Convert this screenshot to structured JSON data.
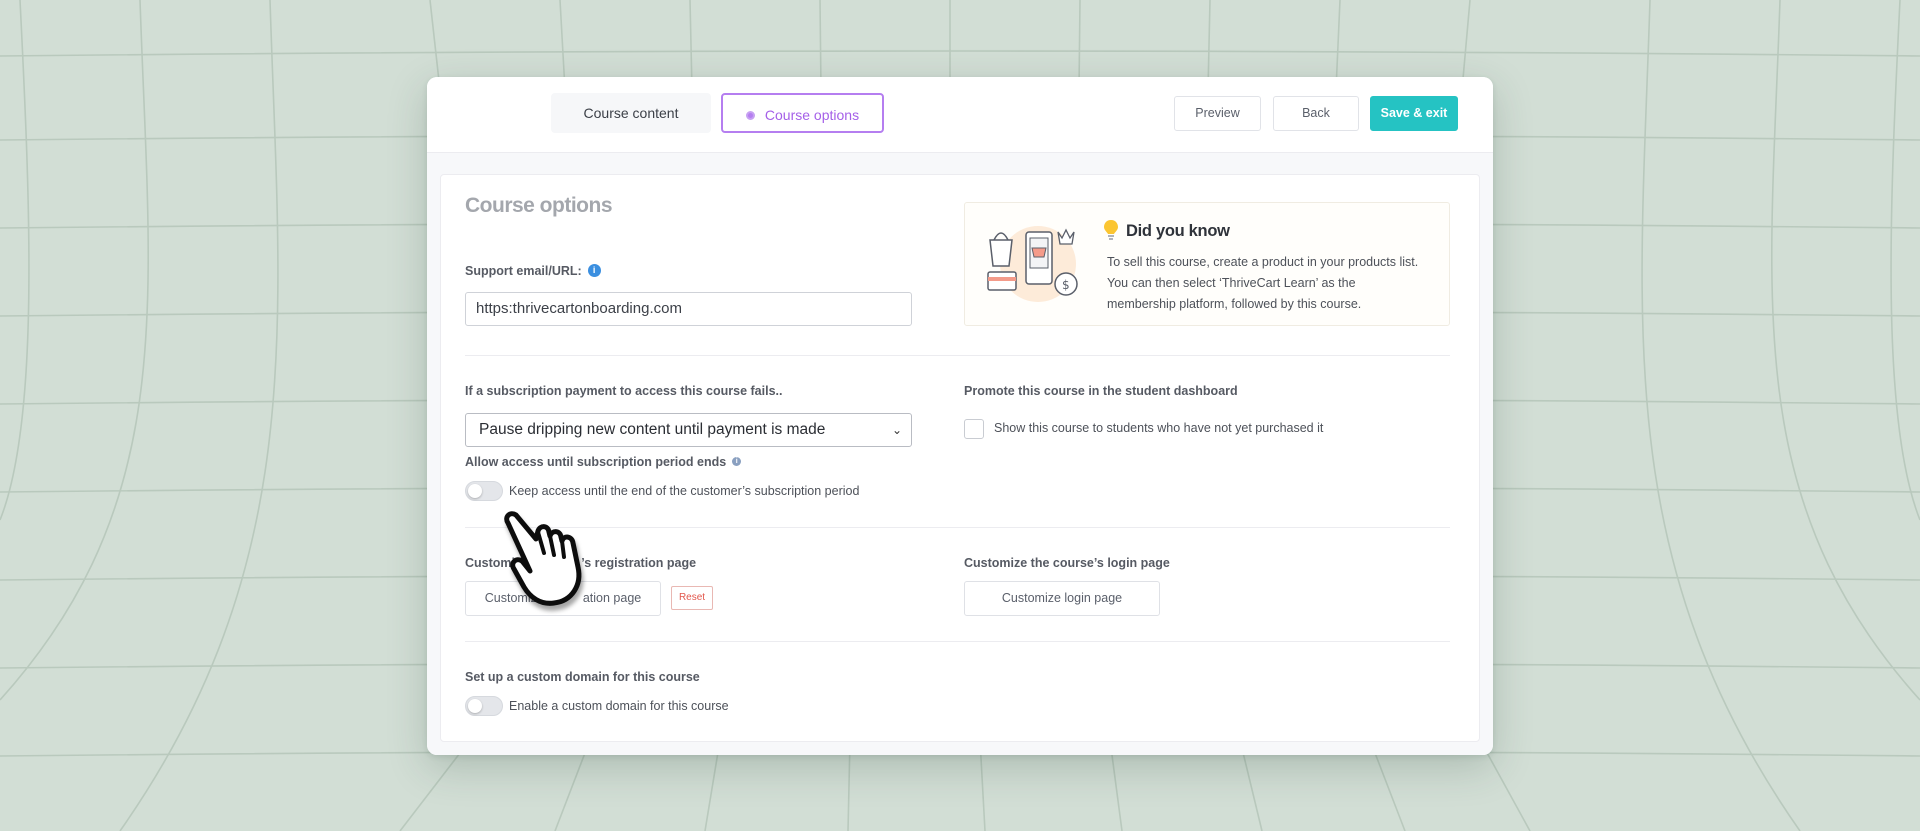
{
  "tabs": {
    "course_content": "Course content",
    "course_options": "Course options"
  },
  "toolbar": {
    "preview": "Preview",
    "back": "Back",
    "save_exit": "Save & exit"
  },
  "page": {
    "title": "Course options"
  },
  "support": {
    "label": "Support email/URL:",
    "value": "https:thrivecartonboarding.com"
  },
  "did_you_know": {
    "title": "Did you know",
    "text": "To sell this course, create a product in your products list. You can then select ‘ThriveCart Learn’ as the membership platform, followed by this course."
  },
  "subscription": {
    "label": "If a subscription payment to access this course fails..",
    "selected": "Pause dripping new content until payment is made"
  },
  "promote": {
    "label": "Promote this course in the student dashboard",
    "checkbox_label": "Show this course to students who have not yet purchased it"
  },
  "access": {
    "label": "Allow access until subscription period ends",
    "toggle_label": "Keep access until the end of the customer’s subscription period"
  },
  "registration": {
    "label_visible_start": "Customiz",
    "label_visible_end": "’s registration page",
    "button_visible_start": "Customiz",
    "button_visible_end": "ation page",
    "reset": "Reset"
  },
  "login": {
    "label": "Customize the course’s login page",
    "button": "Customize login page"
  },
  "domain": {
    "label": "Set up a custom domain for this course",
    "toggle_label": "Enable a custom domain for this course"
  },
  "colors": {
    "accent_purple": "#b57ef0",
    "save_teal": "#25c3c3",
    "reset_red": "#e2574c"
  }
}
